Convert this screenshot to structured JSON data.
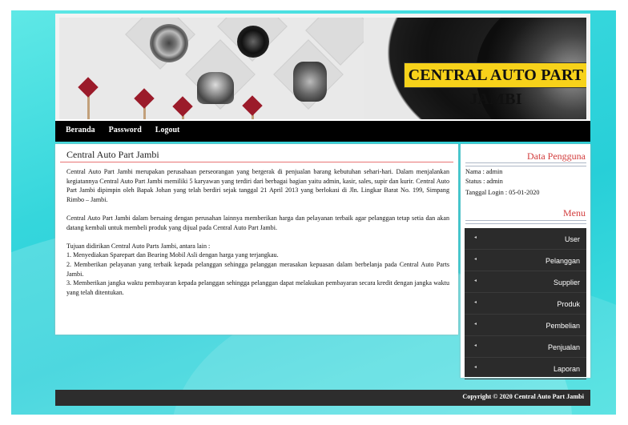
{
  "header": {
    "site_title": "CENTRAL AUTO PART JAMBI"
  },
  "nav": {
    "items": [
      "Beranda",
      "Password",
      "Logout"
    ]
  },
  "main": {
    "title": "Central Auto Part Jambi",
    "paragraph1": "Central Auto Part Jambi merupakan perusahaan perseorangan yang bergerak di penjualan barang kebutuhan sehari-hari. Dalam menjalankan kegiatannya Central Auto Part Jambi memiliki 5 karyawan yang terdiri dari berbagai bagian yaitu admin, kasir, sales, supir dan kurir. Central Auto Part Jambi dipimpin oleh Bapak Johan yang telah berdiri sejak tanggal 21 April 2013 yang berlokasi di Jln. Lingkar Barat No. 199, Simpang Rimbo – Jambi.",
    "paragraph2": "Central Auto Part Jambi dalam bersaing dengan perusahan lainnya memberikan harga dan pelayanan terbaik agar pelanggan tetap setia dan akan datang kembali untuk membeli produk yang dijual pada Central Auto Part Jambi.",
    "list_intro": "Tujuan didirikan Central Auto Parts Jambi, antara lain :",
    "list_items": [
      "1. Menyediakan Sparepart dan Bearing Mobil Asli dengan harga yang terjangkau.",
      "2. Memberikan pelayanan yang terbaik kepada pelanggan sehingga pelanggan merasakan kepuasan dalam berbelanja pada Central Auto Parts Jambi.",
      "3. Memberikan jangka waktu pembayaran kepada pelanggan sehingga pelanggan dapat melakukan pembayaran secara kredit dengan jangka waktu yang telah ditentukan."
    ]
  },
  "sidebar": {
    "user_heading": "Data Pengguna",
    "nama": "Nama : admin",
    "status": "Status : admin",
    "login": "Tanggal Login : 05-01-2020",
    "menu_heading": "Menu",
    "menu_items": [
      "User",
      "Pelanggan",
      "Supplier",
      "Produk",
      "Pembelian",
      "Penjualan",
      "Laporan"
    ],
    "bullet": "◂"
  },
  "footer": {
    "copyright": "Copyright © 2020 Central Auto Part Jambi"
  },
  "colors": {
    "accent": "#d23b3b",
    "title_bg": "#f7d21a",
    "nav_bg": "#000000",
    "menu_bg": "#2b2b2b",
    "background": "#35d6dc"
  }
}
